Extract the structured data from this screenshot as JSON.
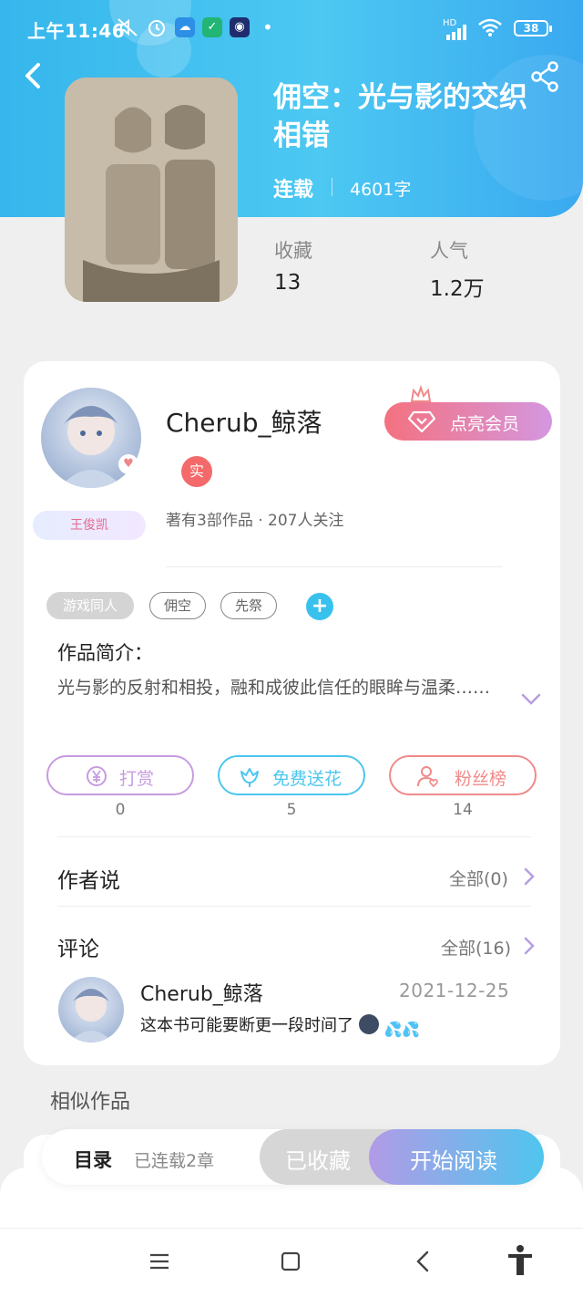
{
  "status_bar": {
    "time": "上午11:46",
    "network": "HD",
    "battery": "38",
    "more_dot": "•"
  },
  "header": {
    "back_icon": "back-arrow-icon",
    "share_icon": "share-icon"
  },
  "book": {
    "title": "佣空：光与影的交织相错",
    "status": "连载",
    "word_count": "4601字",
    "stats": [
      {
        "label": "收藏",
        "value": "13"
      },
      {
        "label": "人气",
        "value": "1.2万"
      }
    ]
  },
  "author": {
    "name": "Cherub_鲸落",
    "verified_label": "实",
    "meta": "著有3部作品 · 207人关注",
    "frame_badge": "王俊凯",
    "vip_button": "点亮会员"
  },
  "tags": [
    "游戏同人",
    "佣空",
    "先祭"
  ],
  "add_tag": "+",
  "intro": {
    "heading": "作品简介：",
    "text": "光与影的反射和相投，融和成彼此信任的眼眸与温柔……"
  },
  "actions": [
    {
      "label": "打赏",
      "count": "0",
      "color": "#c79be0"
    },
    {
      "label": "免费送花",
      "count": "5",
      "color": "#4cc6ee"
    },
    {
      "label": "粉丝榜",
      "count": "14",
      "color": "#f08a8a"
    }
  ],
  "author_says": {
    "title": "作者说",
    "more": "全部(0)"
  },
  "comments": {
    "title": "评论",
    "more": "全部(16)",
    "items": [
      {
        "user": "Cherub_鲸落",
        "date": "2021-12-25",
        "text": "这本书可能要断更一段时间了"
      }
    ]
  },
  "similar": {
    "title": "相似作品"
  },
  "bottom_bar": {
    "toc_label": "目录",
    "toc_meta": "已连载2章",
    "fav_label": "已收藏",
    "read_label": "开始阅读"
  },
  "colors": {
    "header_gradient_start": "#36b6ec",
    "accent_blue": "#39c1ee",
    "vip_gradient": [
      "#f4717f",
      "#d497e0"
    ],
    "read_gradient": [
      "#b19be6",
      "#4fc5ee"
    ]
  }
}
